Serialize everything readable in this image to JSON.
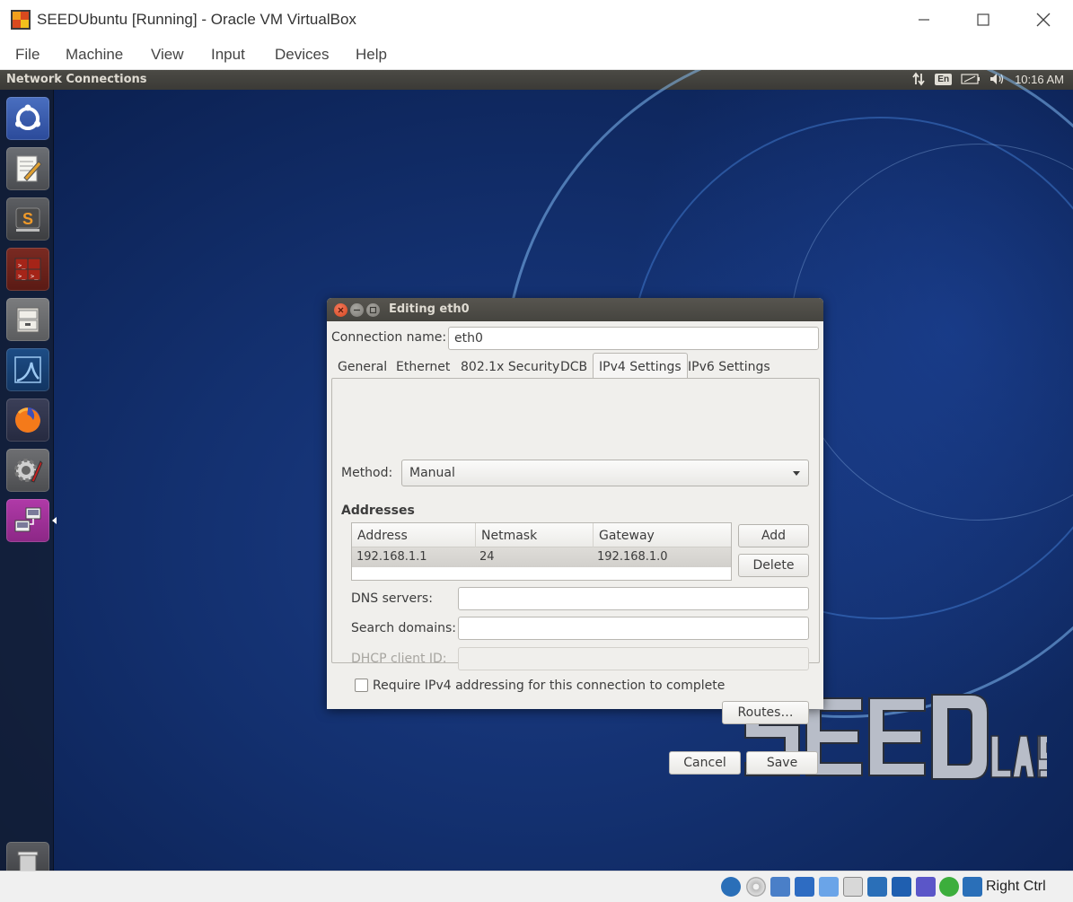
{
  "host": {
    "title": "SEEDUbuntu [Running] - Oracle VM VirtualBox",
    "menu": [
      "File",
      "Machine",
      "View",
      "Input",
      "Devices",
      "Help"
    ],
    "host_key": "Right Ctrl"
  },
  "guest_panel": {
    "title": "Network Connections",
    "language": "En",
    "time": "10:16 AM"
  },
  "launcher": {
    "items": [
      "ubuntu-dash",
      "text-editor",
      "sublime-text",
      "terminal",
      "files",
      "wireshark",
      "firefox",
      "system-settings",
      "network-connections"
    ]
  },
  "dialog": {
    "title": "Editing eth0",
    "connection_name_label": "Connection name:",
    "connection_name_value": "eth0",
    "tabs": [
      "General",
      "Ethernet",
      "802.1x Security",
      "DCB",
      "IPv4 Settings",
      "IPv6 Settings"
    ],
    "active_tab": "IPv4 Settings",
    "method_label": "Method:",
    "method_value": "Manual",
    "addresses_heading": "Addresses",
    "table_headers": [
      "Address",
      "Netmask",
      "Gateway"
    ],
    "table_rows": [
      [
        "192.168.1.1",
        "24",
        "192.168.1.0"
      ]
    ],
    "add_button": "Add",
    "delete_button": "Delete",
    "dns_label": "DNS servers:",
    "dns_value": "",
    "search_label": "Search domains:",
    "search_value": "",
    "dhcp_label": "DHCP client ID:",
    "dhcp_value": "",
    "require_ipv4_label": "Require IPv4 addressing for this connection to complete",
    "require_ipv4_checked": false,
    "routes_button": "Routes…",
    "cancel_button": "Cancel",
    "save_button": "Save"
  },
  "watermark": {
    "text": "SEEDLABS"
  }
}
